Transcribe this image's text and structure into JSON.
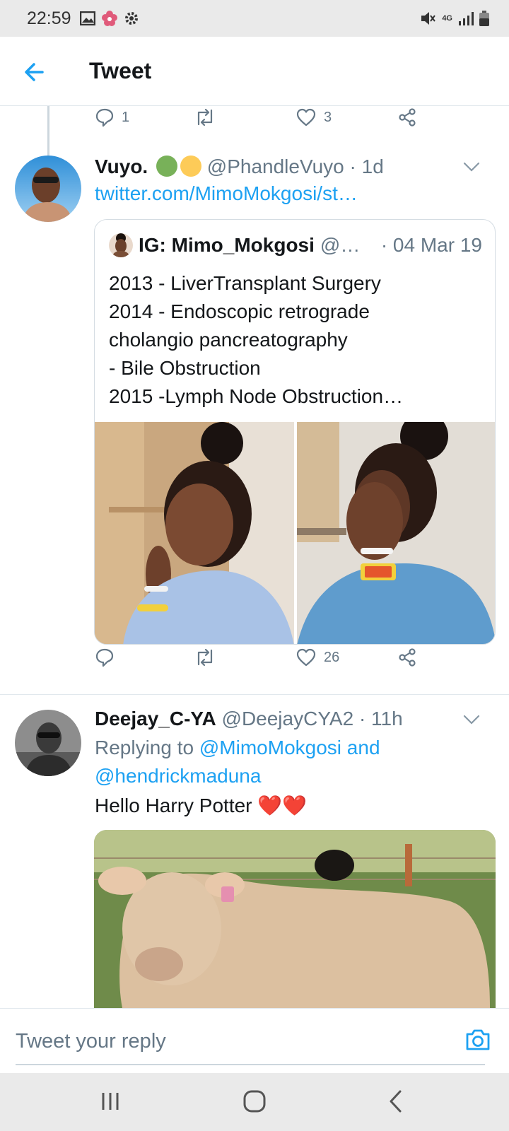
{
  "status_bar": {
    "time": "22:59",
    "network": "4G"
  },
  "app_bar": {
    "title": "Tweet"
  },
  "prev_tweet_actions": {
    "replies": "1",
    "retweets": "",
    "likes": "3"
  },
  "tweet1": {
    "name": "Vuyo.",
    "handle": "@PhandleVuyo",
    "time": "· 1d",
    "link": "twitter.com/MimoMokgosi/st…",
    "quote": {
      "name": "IG: Mimo_Mokgosi",
      "handle": "@…",
      "date": "· 04 Mar 19",
      "lines": [
        "2013 - LiverTransplant Surgery",
        "2014 - Endoscopic retrograde",
        "cholangio pancreatography",
        "- Bile Obstruction",
        "2015 -Lymph Node Obstruction…"
      ]
    },
    "actions": {
      "replies": "",
      "retweets": "",
      "likes": "26"
    }
  },
  "tweet2": {
    "name": "Deejay_C-YA",
    "handle": "@DeejayCYA2",
    "time": "· 11h",
    "replying_prefix": "Replying to",
    "mention1": "@MimoMokgosi",
    "and_word": "and",
    "mention2": "@hendrickmaduna",
    "text": "Hello Harry Potter",
    "emoji": "❤️❤️"
  },
  "compose": {
    "placeholder": "Tweet your reply"
  },
  "colors": {
    "accent": "#1da1f2",
    "secondary_text": "#657786",
    "heart": "#e0245e"
  }
}
